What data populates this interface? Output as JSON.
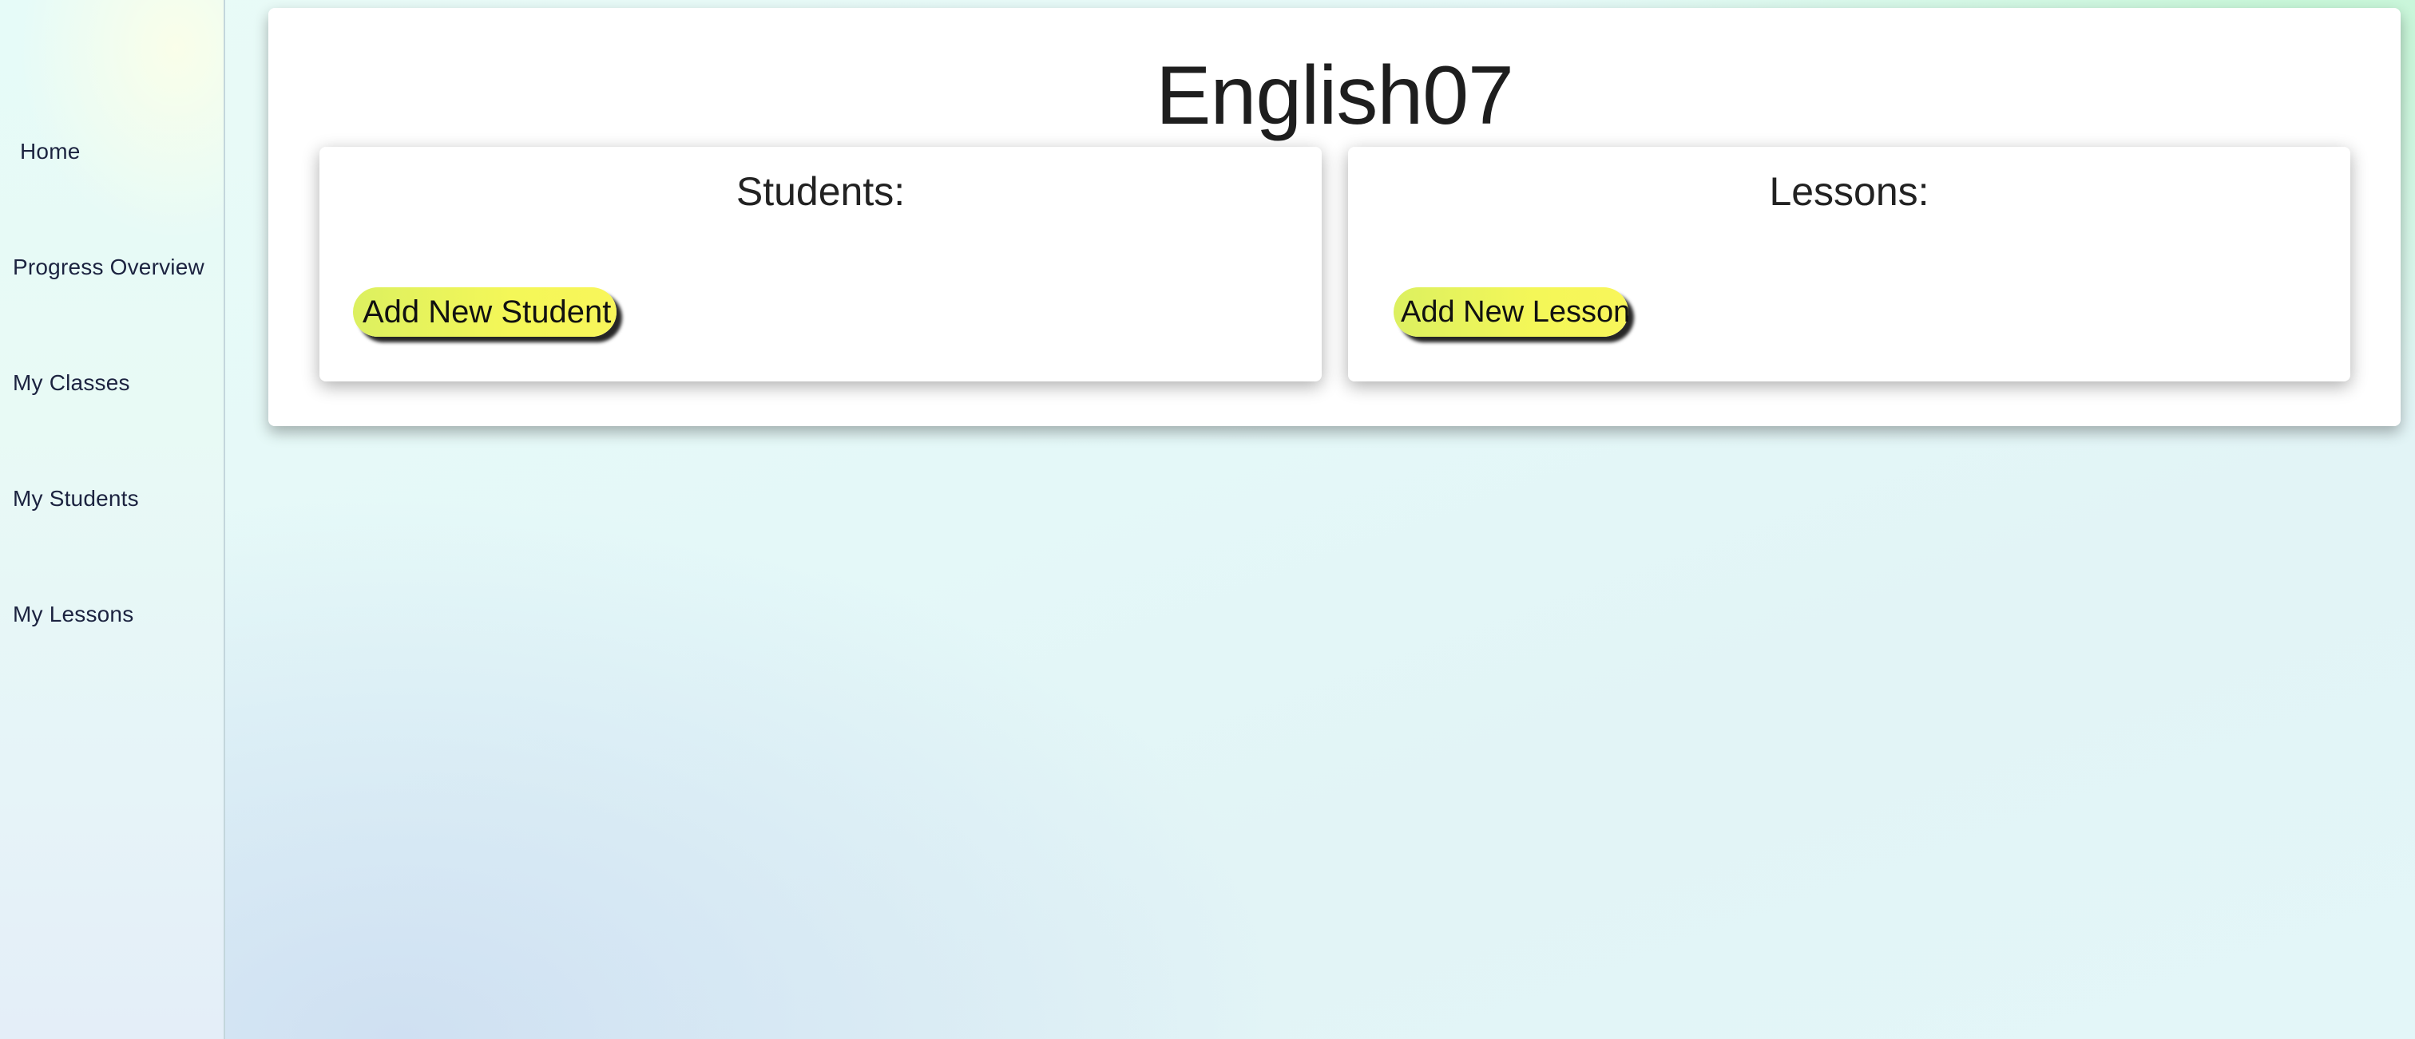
{
  "sidebar": {
    "items": [
      {
        "label": "Home"
      },
      {
        "label": "Progress Overview"
      },
      {
        "label": "My Classes"
      },
      {
        "label": "My Students"
      },
      {
        "label": "My Lessons"
      }
    ]
  },
  "main": {
    "title": "English07",
    "students_panel": {
      "title": "Students:",
      "add_button": "Add New Student"
    },
    "lessons_panel": {
      "title": "Lessons:",
      "add_button": "Add New Lesson"
    }
  },
  "colors": {
    "button_yellow": "#f4f758",
    "button_green_tint": "#dcf060",
    "nav_text": "#1c2340"
  }
}
